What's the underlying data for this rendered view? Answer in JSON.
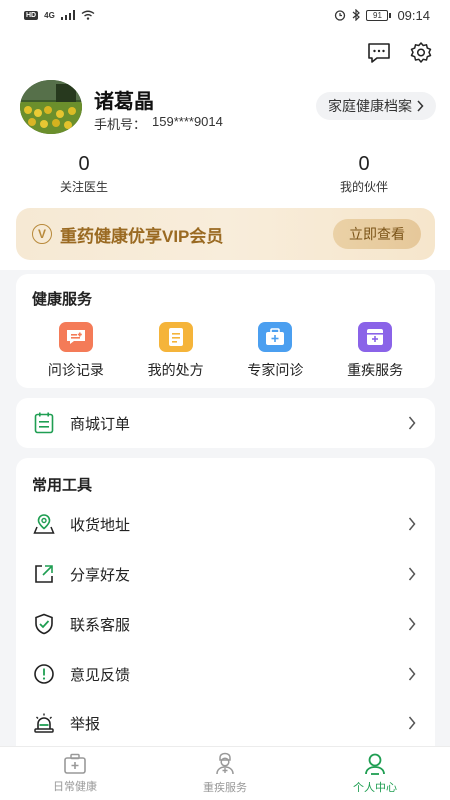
{
  "status_bar": {
    "left_badge": "HD",
    "network": "4G",
    "battery": "91",
    "time": "09:14"
  },
  "header": {
    "icons": [
      "message-icon",
      "gear-icon"
    ]
  },
  "profile": {
    "name": "诸葛晶",
    "phone_label": "手机号：",
    "phone": "159****9014",
    "family_button": "家庭健康档案"
  },
  "stats": [
    {
      "value": "0",
      "label": "关注医生"
    },
    {
      "value": "0",
      "label": "我的伙伴"
    }
  ],
  "vip": {
    "badge": "V",
    "text": "重药健康优享VIP会员",
    "button": "立即查看"
  },
  "health_services": {
    "title": "健康服务",
    "items": [
      {
        "label": "问诊记录",
        "icon": "consult-record-icon",
        "color": "#f47b58"
      },
      {
        "label": "我的处方",
        "icon": "prescription-icon",
        "color": "#f5b43a"
      },
      {
        "label": "专家问诊",
        "icon": "expert-consult-icon",
        "color": "#4b9ff0"
      },
      {
        "label": "重疾服务",
        "icon": "critical-illness-icon",
        "color": "#8a63e8"
      }
    ]
  },
  "mall_order": {
    "label": "商城订单",
    "icon": "order-list-icon"
  },
  "tools": {
    "title": "常用工具",
    "items": [
      {
        "label": "收货地址",
        "icon": "location-icon"
      },
      {
        "label": "分享好友",
        "icon": "share-icon"
      },
      {
        "label": "联系客服",
        "icon": "shield-check-icon"
      },
      {
        "label": "意见反馈",
        "icon": "feedback-icon"
      },
      {
        "label": "举报",
        "icon": "alarm-icon"
      }
    ]
  },
  "bottom_nav": [
    {
      "label": "日常健康",
      "icon": "medical-kit-icon",
      "active": false
    },
    {
      "label": "重疾服务",
      "icon": "doctor-icon",
      "active": false
    },
    {
      "label": "个人中心",
      "icon": "person-icon",
      "active": true
    }
  ],
  "colors": {
    "accent_green": "#1f9e52",
    "vip_gold": "#9a6a22",
    "page_bg": "#f4f5f7"
  }
}
